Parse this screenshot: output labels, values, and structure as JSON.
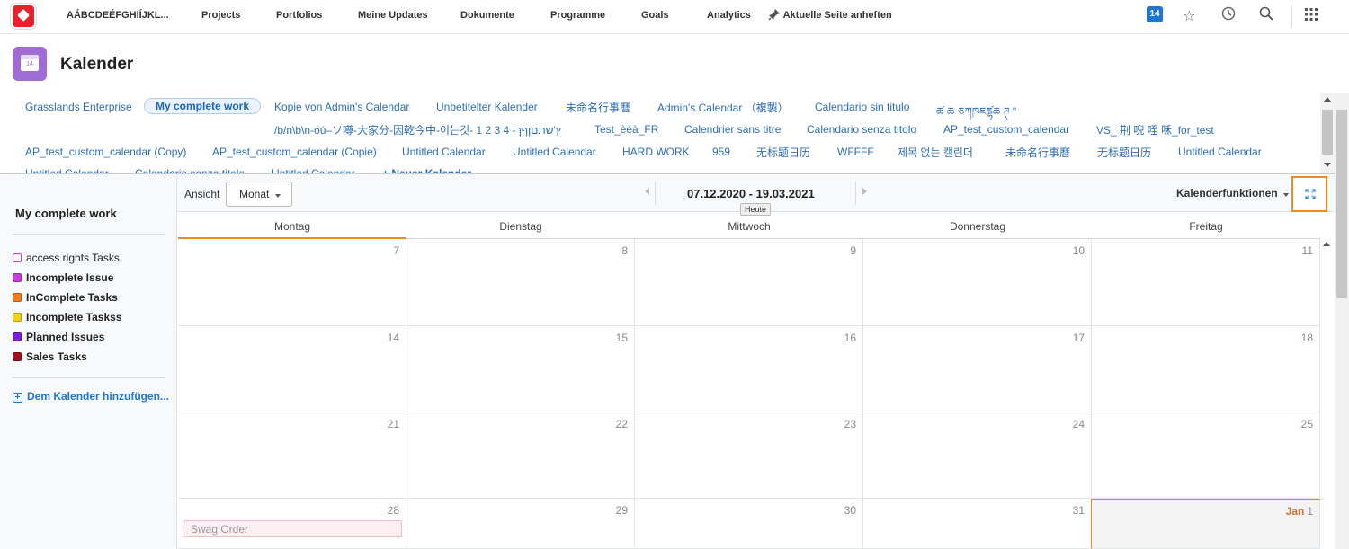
{
  "topnav": {
    "org_name": "AÁBCDEÉFGHIÍJKL...",
    "items": [
      "Projects",
      "Portfolios",
      "Meine Updates",
      "Dokumente",
      "Programme",
      "Goals",
      "Analytics"
    ],
    "pin_label": "Aktuelle Seite anheften",
    "notification_count": "14"
  },
  "header": {
    "icon_day": "14",
    "title": "Kalender"
  },
  "calendar_tabs": {
    "row1": [
      "Grasslands Enterprise",
      "My complete work",
      "Kopie von Admin's Calendar",
      "Unbetitelter Kalender",
      "未命名行事曆",
      "Admin's Calendar （複製）",
      "Calendario sin titulo",
      "ཚ ཆ ཅཀཁཇཛྷཆ ཊ \""
    ],
    "row2": [
      "/b/n\\b\\n-óú–ソ噂-大家分-因乾今中-이는것- 1 2 3 4 -ץ'שתםןףך",
      "Test_èéà_FR",
      "Calendrier sans titre",
      "Calendario senza titolo",
      "AP_test_custom_calendar",
      "VS_ 荆 唲 咥 咊_for_test"
    ],
    "row3": [
      "AP_test_custom_calendar (Copy)",
      "AP_test_custom_calendar (Copie)",
      "Untitled Calendar",
      "Untitled Calendar",
      "HARD WORK",
      "959",
      "无标题日历",
      "WFFFF",
      "제목 없는 캘린더",
      "未命名行事曆",
      "无标题日历",
      "Untitled Calendar"
    ],
    "row4": [
      "Untitled Calendar",
      "Calendario senza titolo",
      "Untitled Calendar",
      "+ Neuer Kalender"
    ],
    "active": "My complete work"
  },
  "sidebar": {
    "title": "My complete work",
    "legend": [
      {
        "label": "access rights Tasks",
        "color": "#ffffff",
        "bold": false
      },
      {
        "label": "Incomplete Issue",
        "color": "#c53ddb",
        "bold": true
      },
      {
        "label": "InComplete Tasks",
        "color": "#f07e1a",
        "bold": true
      },
      {
        "label": "Incomplete Taskss",
        "color": "#f2d21b",
        "bold": true
      },
      {
        "label": "Planned Issues",
        "color": "#7a1fd6",
        "bold": true
      },
      {
        "label": "Sales Tasks",
        "color": "#a3101f",
        "bold": true
      }
    ],
    "add_label": "Dem Kalender hinzufügen..."
  },
  "toolbar": {
    "view_label": "Ansicht",
    "view_value": "Monat",
    "date_range": "07.12.2020 - 19.03.2021",
    "today_tooltip": "Heute",
    "functions_label": "Kalenderfunktionen"
  },
  "grid": {
    "days": [
      "Montag",
      "Dienstag",
      "Mittwoch",
      "Donnerstag",
      "Freitag"
    ],
    "weeks": [
      [
        "7",
        "8",
        "9",
        "10",
        "11"
      ],
      [
        "14",
        "15",
        "16",
        "17",
        "18"
      ],
      [
        "21",
        "22",
        "23",
        "24",
        "25"
      ],
      [
        "28",
        "29",
        "30",
        "31",
        "1"
      ]
    ],
    "jan_label": "Jan",
    "event_label": "Swag Order"
  }
}
